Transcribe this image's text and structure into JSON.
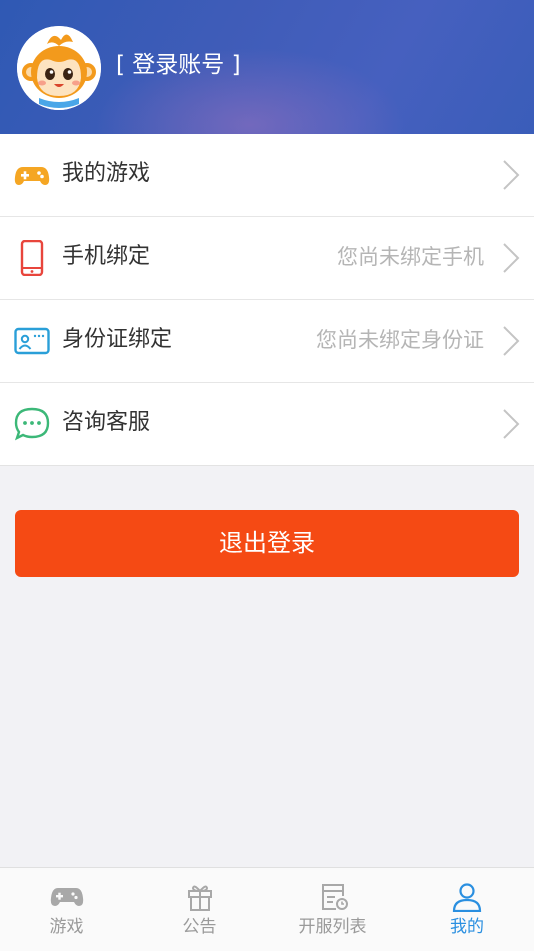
{
  "header": {
    "login_label": "[ 登录账号 ]"
  },
  "menu": [
    {
      "label": "我的游戏",
      "hint": "",
      "icon": "gamepad-icon",
      "color": "#f5a623"
    },
    {
      "label": "手机绑定",
      "hint": "您尚未绑定手机",
      "icon": "phone-icon",
      "color": "#e8453c"
    },
    {
      "label": "身份证绑定",
      "hint": "您尚未绑定身份证",
      "icon": "id-card-icon",
      "color": "#2a9fd8"
    },
    {
      "label": "咨询客服",
      "hint": "",
      "icon": "chat-bubble-icon",
      "color": "#3cb878"
    }
  ],
  "logout_label": "退出登录",
  "tabs": [
    {
      "label": "游戏",
      "icon": "gamepad-icon",
      "active": false
    },
    {
      "label": "公告",
      "icon": "gift-icon",
      "active": false
    },
    {
      "label": "开服列表",
      "icon": "server-list-icon",
      "active": false
    },
    {
      "label": "我的",
      "icon": "user-icon",
      "active": true
    }
  ],
  "colors": {
    "accent": "#f54a14",
    "tab_active": "#2a8fe0",
    "header": "#3a5db9"
  }
}
